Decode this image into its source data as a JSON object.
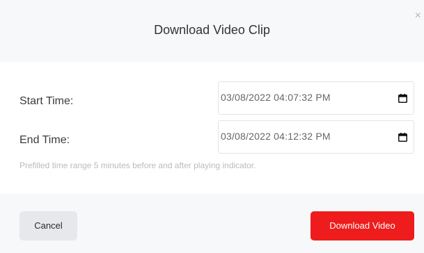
{
  "dialog": {
    "title": "Download Video Clip",
    "close_label": "×"
  },
  "form": {
    "start_label": "Start Time:",
    "start_value": "03/08/2022 04:07:32 PM",
    "end_label": "End Time:",
    "end_value": "03/08/2022 04:12:32 PM",
    "helper_text": "Prefilled time range 5 minutes before and after playing indicator."
  },
  "actions": {
    "cancel_label": "Cancel",
    "download_label": "Download Video"
  },
  "colors": {
    "accent": "#ee1c1c",
    "header_bg": "#f7f8fa",
    "cancel_bg": "#e6e8ec"
  },
  "icons": {
    "close": "close-icon",
    "calendar": "calendar-icon"
  }
}
